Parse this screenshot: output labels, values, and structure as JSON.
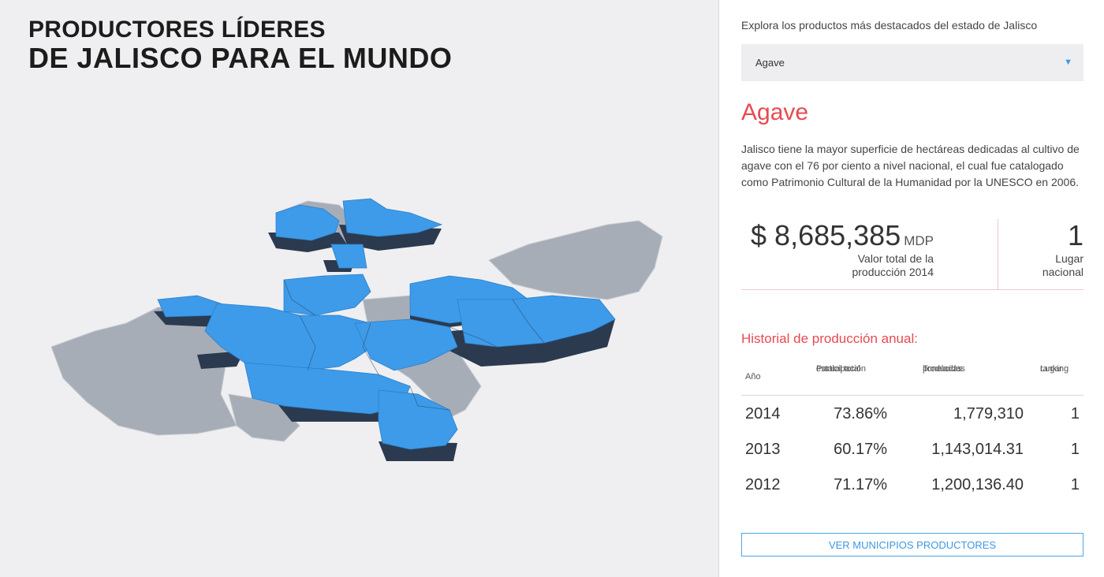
{
  "header": {
    "title_line1": "PRODUCTORES LÍDERES",
    "title_line2": "DE JALISCO PARA EL MUNDO"
  },
  "map": {
    "highlight_color": "#3d9be9",
    "shadow_color": "#2b3a4f",
    "base_color": "#a7adb7"
  },
  "panel": {
    "prompt": "Explora los productos más destacados del estado de Jalisco",
    "select": {
      "value": "Agave",
      "icon": "caret-down-icon"
    },
    "product_name": "Agave",
    "description": "Jalisco tiene la mayor superficie de hectáreas dedicadas al cultivo de agave con el 76 por ciento a nivel nacional, el cual fue catalogado como Patrimonio Cultural de la Humanidad por la UNESCO en 2006.",
    "stats": {
      "value": "$ 8,685,385",
      "unit": "MDP",
      "value_label_l1": "Valor total de la",
      "value_label_l2": "producción 2014",
      "rank": "1",
      "rank_label_l1": "Lugar",
      "rank_label_l2": "nacional"
    },
    "history_title": "Historial de producción anual:",
    "table": {
      "headers": {
        "year": "Año",
        "part_l1": "Participación",
        "part_l2": "estatal total",
        "ton_l1": "Toneladas",
        "ton_l2": "producidas",
        "rank_l1": "Lugar",
        "rank_l2": "ranking"
      },
      "rows": [
        {
          "year": "2014",
          "part": "73.86%",
          "ton": "1,779,310",
          "rank": "1"
        },
        {
          "year": "2013",
          "part": "60.17%",
          "ton": "1,143,014.31",
          "rank": "1"
        },
        {
          "year": "2012",
          "part": "71.17%",
          "ton": "1,200,136.40",
          "rank": "1"
        }
      ]
    },
    "button_label": "VER MUNICIPIOS PRODUCTORES",
    "accent_color": "#e84a50",
    "link_color": "#3f97e0"
  }
}
